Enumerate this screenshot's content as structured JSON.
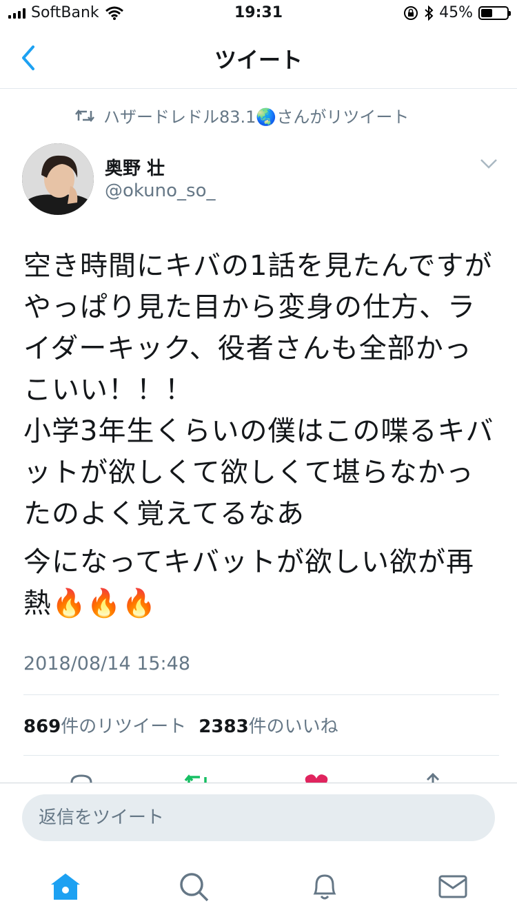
{
  "status_bar": {
    "carrier": "SoftBank",
    "time": "19:31",
    "battery_text": "45%",
    "battery_level": 0.45
  },
  "nav": {
    "title": "ツイート"
  },
  "retweet_banner": {
    "text": "ハザードレドル83.1🌏さんがリツイート"
  },
  "author": {
    "name": "奥野 壮",
    "handle": "@okuno_so_"
  },
  "tweet": {
    "paragraph1": "空き時間にキバの1話を見たんですがやっぱり見た目から変身の仕方、ライダーキック、役者さんも全部かっこいい！！！\n小学3年生くらいの僕はこの喋るキバットが欲しくて欲しくて堪らなかったのよく覚えてるなあ",
    "paragraph2": "今になってキバットが欲しい欲が再熱🔥🔥🔥",
    "timestamp": "2018/08/14 15:48"
  },
  "stats": {
    "retweets_count": "869",
    "retweets_label": "件のリツイート",
    "likes_count": "2383",
    "likes_label": "件のいいね"
  },
  "reply_bar": {
    "placeholder": "返信をツイート"
  },
  "colors": {
    "accent": "#1da1f2",
    "retweet_green": "#17bf63",
    "like_red": "#e0245e",
    "secondary_text": "#657786"
  },
  "tab_bar": {
    "items": [
      "home-icon",
      "search-icon",
      "notifications-icon",
      "messages-icon"
    ]
  }
}
